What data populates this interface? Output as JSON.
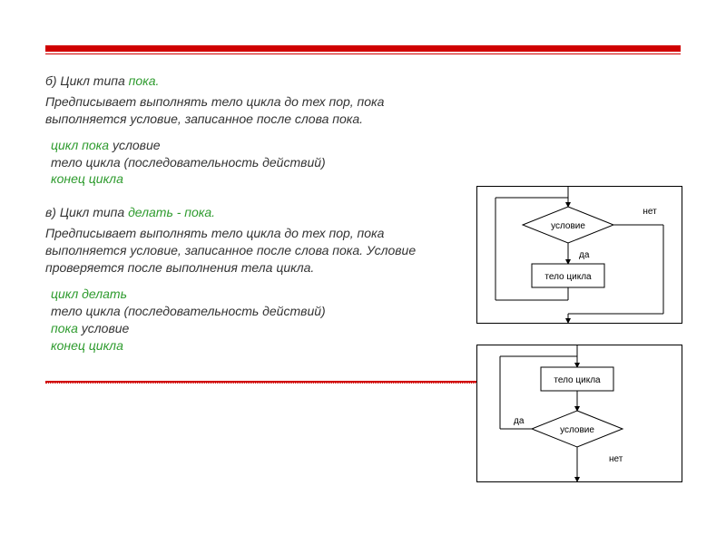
{
  "section_b": {
    "heading_prefix": "б) Цикл типа ",
    "heading_keyword": "пока.",
    "description": "Предписывает выполнять тело цикла до тех пор, пока выполняется условие, записанное после слова пока.",
    "code": {
      "l1_kw": "цикл пока",
      "l1_rest": " условие",
      "l2": "тело цикла (последовательность действий)",
      "l3": "конец цикла"
    }
  },
  "section_v": {
    "heading_prefix": "в) Цикл типа ",
    "heading_keyword": "делать - пока.",
    "description": "Предписывает выполнять тело цикла до тех пор, пока выполняется условие, записанное после слова пока. Условие проверяется после выполнения тела цикла.",
    "code": {
      "l1": "цикл делать",
      "l2": "тело цикла (последовательность действий)",
      "l3_kw": "пока",
      "l3_rest": " условие",
      "l4": "конец цикла"
    }
  },
  "diagram": {
    "condition": "условие",
    "body": "тело цикла",
    "no": "нет",
    "yes": "да"
  }
}
